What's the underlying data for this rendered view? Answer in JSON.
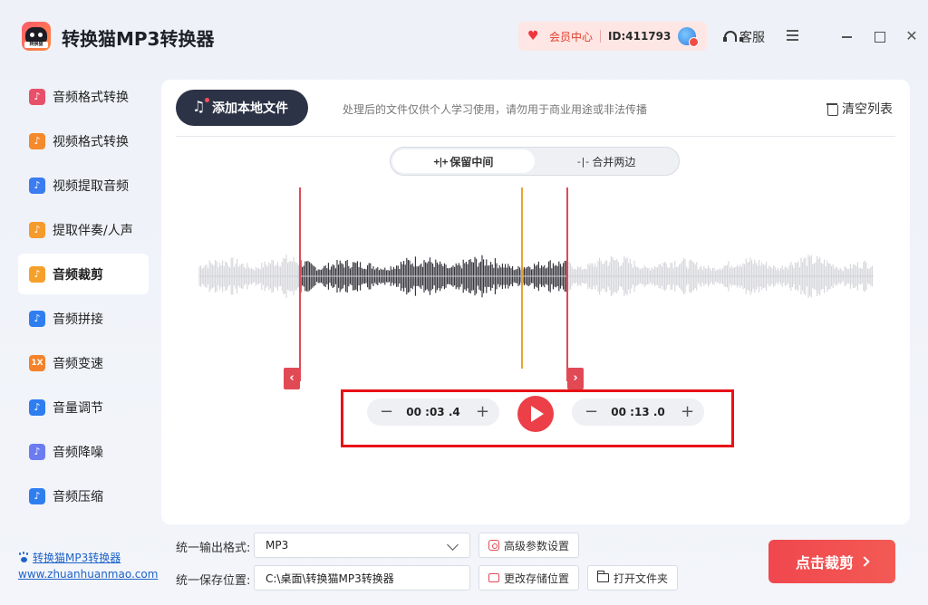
{
  "app": {
    "title": "转换猫MP3转换器",
    "logo_text": "转换猫"
  },
  "header": {
    "member_center": "会员中心",
    "user_id": "ID:411793",
    "service": "客服"
  },
  "sidebar": {
    "items": [
      {
        "label": "音频格式转换",
        "icon": "format-convert-icon",
        "color": "#e8506a"
      },
      {
        "label": "视频格式转换",
        "icon": "video-convert-icon",
        "color": "#f58a2b"
      },
      {
        "label": "视频提取音频",
        "icon": "video-extract-icon",
        "color": "#3b7cf0"
      },
      {
        "label": "提取伴奏/人声",
        "icon": "vocal-extract-icon",
        "color": "#f59a2b"
      },
      {
        "label": "音频裁剪",
        "icon": "audio-cut-icon",
        "color": "#f5a02b",
        "active": true
      },
      {
        "label": "音频拼接",
        "icon": "audio-join-icon",
        "color": "#2f7ef0"
      },
      {
        "label": "音频变速",
        "icon": "speed-icon",
        "color": "#f5822b",
        "glyph": "1X"
      },
      {
        "label": "音量调节",
        "icon": "volume-icon",
        "color": "#2f7ef0"
      },
      {
        "label": "音频降噪",
        "icon": "denoise-icon",
        "color": "#6b7cf0"
      },
      {
        "label": "音频压缩",
        "icon": "compress-icon",
        "color": "#2f7ef0"
      }
    ],
    "brand_link": "转换猫MP3转换器",
    "brand_url": "www.zhuanhuanmao.com"
  },
  "main": {
    "add_button": "添加本地文件",
    "notice": "处理后的文件仅供个人学习使用，请勿用于商业用途或非法传播",
    "clear_list": "清空列表",
    "modes": [
      "保留中间",
      "合并两边"
    ],
    "active_mode": 0,
    "start_time": "00 :03 .4",
    "end_time": "00 :13 .0",
    "minus": "−",
    "plus": "+"
  },
  "bottom": {
    "format_label": "统一输出格式:",
    "format_value": "MP3",
    "advanced": "高级参数设置",
    "save_label": "统一保存位置:",
    "save_path": "C:\\桌面\\转换猫MP3转换器",
    "change_location": "更改存储位置",
    "open_folder": "打开文件夹",
    "cut_button": "点击裁剪"
  },
  "colors": {
    "accent": "#ec3f47",
    "playhead": "#e8a233",
    "highlight_frame": "#e81216"
  }
}
